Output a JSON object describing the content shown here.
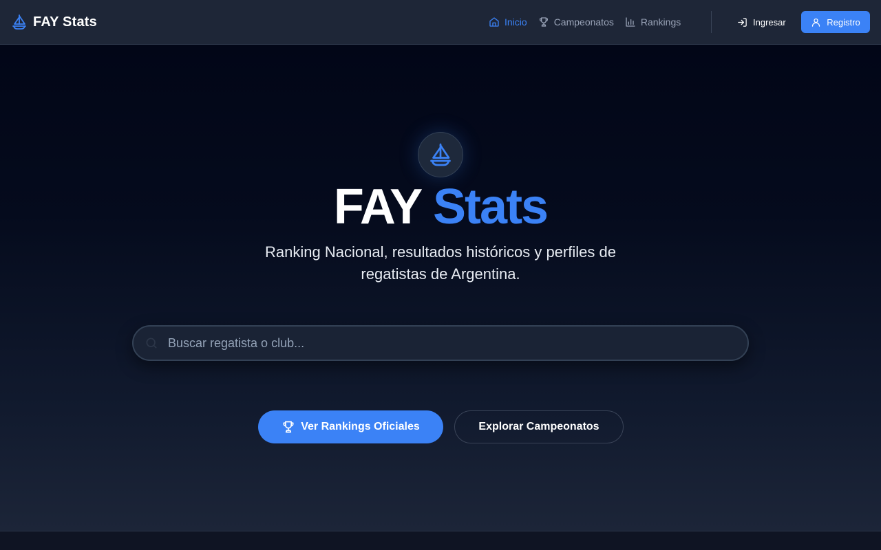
{
  "brand": {
    "name": "FAY Stats",
    "icon": "sailboat-icon",
    "accent": "#3b82f6"
  },
  "nav": {
    "items": [
      {
        "label": "Inicio",
        "icon": "home-icon",
        "active": true
      },
      {
        "label": "Campeonatos",
        "icon": "trophy-icon",
        "active": false
      },
      {
        "label": "Rankings",
        "icon": "bar-chart-icon",
        "active": false
      }
    ],
    "login_label": "Ingresar",
    "register_label": "Registro"
  },
  "hero": {
    "title_part1": "FAY",
    "title_part2": "Stats",
    "subtitle": "Ranking Nacional, resultados históricos y perfiles de regatistas de Argentina.",
    "search_placeholder": "Buscar regatista o club...",
    "search_value": "",
    "primary_cta": "Ver Rankings Oficiales",
    "secondary_cta": "Explorar Campeonatos"
  },
  "colors": {
    "accent": "#3b82f6",
    "header_bg": "#1e2637",
    "hero_bg_top": "#020617",
    "muted_text": "#9aa4b8"
  }
}
